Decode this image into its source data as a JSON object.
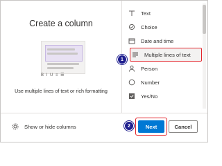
{
  "dialog": {
    "title": "Create a column",
    "description": "Use multiple lines of text or rich formatting",
    "format_toolbar": "B I U ≡ ☰"
  },
  "column_types": [
    {
      "label": "Text",
      "icon": "text-icon"
    },
    {
      "label": "Choice",
      "icon": "choice-icon"
    },
    {
      "label": "Date and time",
      "icon": "calendar-icon"
    },
    {
      "label": "Multiple lines of text",
      "icon": "multiline-text-icon",
      "selected": true
    },
    {
      "label": "Person",
      "icon": "person-icon"
    },
    {
      "label": "Number",
      "icon": "number-icon"
    },
    {
      "label": "Yes/No",
      "icon": "yes-no-icon"
    }
  ],
  "footer": {
    "show_hide_label": "Show or hide columns",
    "next_label": "Next",
    "cancel_label": "Cancel"
  },
  "annotations": {
    "step1": "1",
    "step2": "2"
  },
  "colors": {
    "accent": "#0078d4",
    "highlight": "#e3242b",
    "badge": "#1f1f8f"
  }
}
